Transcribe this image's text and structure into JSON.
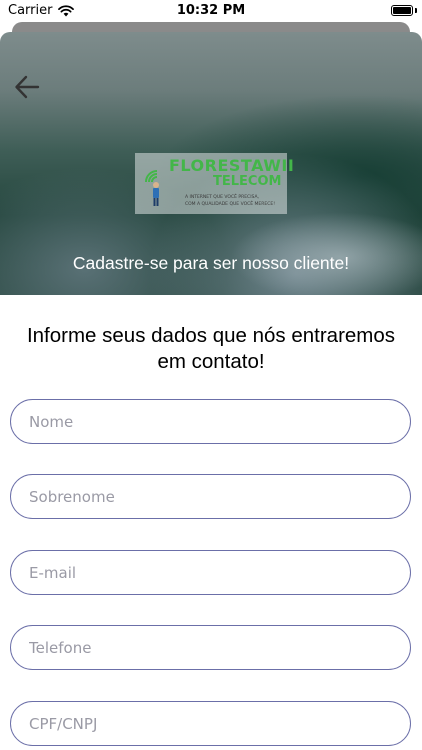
{
  "status_bar": {
    "carrier": "Carrier",
    "time": "10:32 PM"
  },
  "hero": {
    "logo_main": "FLORESTAWII",
    "logo_sub": "TELECOM",
    "logo_tagline_1": "A INTERNET QUE VOCÊ PRECISA,",
    "logo_tagline_2": "COM A QUALIDADE QUE VOCÊ MERECE!",
    "caption": "Cadastre-se para ser nosso cliente!"
  },
  "form": {
    "title": "Informe seus dados que nós entraremos em contato!",
    "fields": [
      {
        "placeholder": "Nome",
        "value": ""
      },
      {
        "placeholder": "Sobrenome",
        "value": ""
      },
      {
        "placeholder": "E-mail",
        "value": ""
      },
      {
        "placeholder": "Telefone",
        "value": ""
      },
      {
        "placeholder": "CPF/CNPJ",
        "value": ""
      }
    ]
  },
  "colors": {
    "field_border": "#6b6fa8",
    "logo_green": "#43b649"
  },
  "icons": {
    "back": "arrow-left-icon",
    "wifi": "wifi-icon",
    "battery": "battery-icon"
  }
}
